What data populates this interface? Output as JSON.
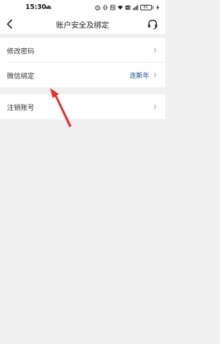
{
  "status_bar": {
    "time": "15:30",
    "battery": "61"
  },
  "navbar": {
    "title": "账户安全及绑定"
  },
  "settings": {
    "rows": [
      {
        "label": "修改密码",
        "value": ""
      },
      {
        "label": "微信绑定",
        "value": "连斯年"
      },
      {
        "label": "注销账号",
        "value": ""
      }
    ]
  },
  "colors": {
    "accent_value": "#1d4a8f",
    "annotation_arrow": "#e8302e"
  }
}
